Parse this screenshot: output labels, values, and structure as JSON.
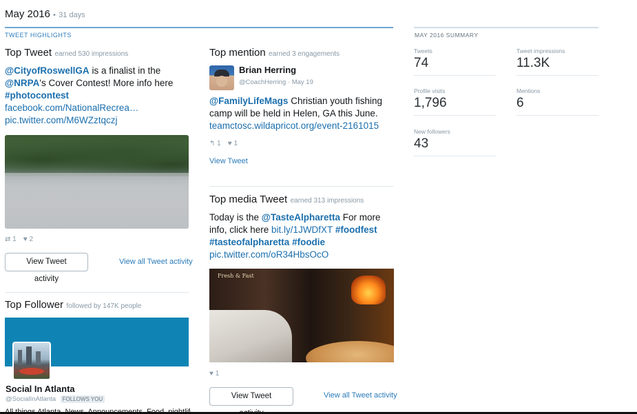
{
  "header": {
    "month": "May 2016",
    "bullet": "•",
    "days": "31 days",
    "highlights_label": "TWEET HIGHLIGHTS"
  },
  "top_tweet": {
    "title": "Top Tweet",
    "subtitle": "earned 530 impressions",
    "mention1": "@CityofRoswellGA",
    "text1": " is a finalist in the ",
    "mention2": "@NRPA",
    "text2": "'s Cover Contest! More info here ",
    "hashtag": "#photocontest",
    "link1": "facebook.com/NationalRecrea…",
    "link2": "pic.twitter.com/M6WZztqczj",
    "retweets": "1",
    "likes": "2",
    "button": "View Tweet activity",
    "all_link": "View all Tweet activity"
  },
  "top_mention": {
    "title": "Top mention",
    "subtitle": "earned 3 engagements",
    "name": "Brian Herring",
    "handle": "@CoachHerring",
    "date": "May 19",
    "mention": "@FamilyLifeMags",
    "text": " Christian youth fishing camp will be held in Helen, GA this June.",
    "link": "teamctosc.wildapricot.org/event-2161015",
    "replies": "1",
    "likes": "1",
    "view_link": "View Tweet"
  },
  "top_media": {
    "title": "Top media Tweet",
    "subtitle": "earned 313 impressions",
    "text1": "Today is the ",
    "mention": "@TasteAlpharetta",
    "text2": " For more info, click here ",
    "link1": "bit.ly/1JWDfXT",
    "space": " ",
    "hashtag1": "#foodfest",
    "hashtag2": "#tasteofalpharetta",
    "hashtag3": "#foodie",
    "link2": "pic.twitter.com/oR34HbsOcO",
    "image_sign": "Fresh & Fast",
    "likes": "1",
    "button": "View Tweet activity",
    "all_link": "View all Tweet activity"
  },
  "top_follower": {
    "title": "Top Follower",
    "subtitle": "followed by 147K people",
    "name": "Social In Atlanta",
    "handle": "@SocialInAtlanta",
    "badge": "FOLLOWS YOU",
    "bio_cutoff": "All things Atlanta. News, Announcements, Food, nightlife..."
  },
  "summary": {
    "label": "MAY 2016 SUMMARY",
    "metrics": [
      {
        "label": "Tweets",
        "value": "74"
      },
      {
        "label": "Tweet impressions",
        "value": "11.3K"
      },
      {
        "label": "Profile visits",
        "value": "1,796"
      },
      {
        "label": "Mentions",
        "value": "6"
      },
      {
        "label": "New followers",
        "value": "43"
      }
    ]
  },
  "icons": {
    "retweet": "⇄",
    "reply": "↰",
    "heart": "♥"
  }
}
